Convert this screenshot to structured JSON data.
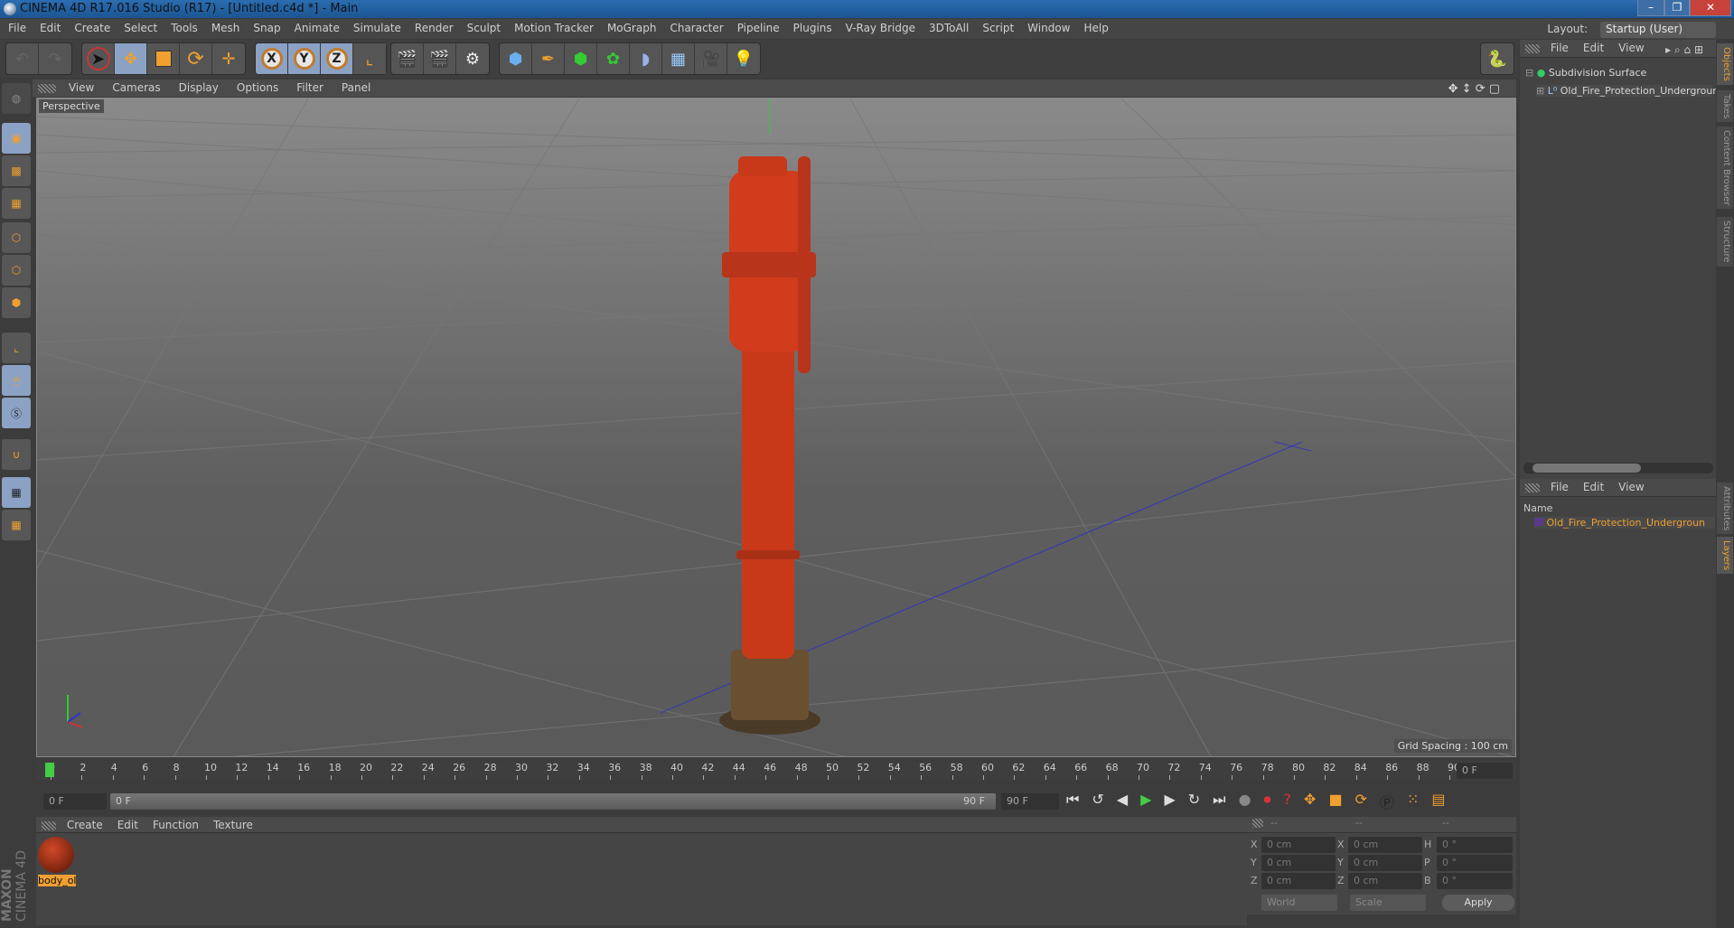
{
  "window": {
    "title": "CINEMA 4D R17.016 Studio (R17) - [Untitled.c4d *] - Main",
    "minimize": "–",
    "maximize": "❐",
    "close": "✕"
  },
  "menubar": {
    "items": [
      "File",
      "Edit",
      "Create",
      "Select",
      "Tools",
      "Mesh",
      "Snap",
      "Animate",
      "Simulate",
      "Render",
      "Sculpt",
      "Motion Tracker",
      "MoGraph",
      "Character",
      "Pipeline",
      "Plugins",
      "V-Ray Bridge",
      "3DToAll",
      "Script",
      "Window",
      "Help"
    ],
    "layout_label": "Layout:",
    "layout_value": "Startup (User)"
  },
  "toolbar": {
    "undo": "undo-icon",
    "redo": "redo-icon",
    "axis_x": "X",
    "axis_y": "Y",
    "axis_z": "Z"
  },
  "viewport": {
    "menu": [
      "View",
      "Cameras",
      "Display",
      "Options",
      "Filter",
      "Panel"
    ],
    "camera_label": "Perspective",
    "grid_spacing": "Grid Spacing : 100 cm"
  },
  "timeline": {
    "ticks": [
      "0",
      "2",
      "4",
      "6",
      "8",
      "10",
      "12",
      "14",
      "16",
      "18",
      "20",
      "22",
      "24",
      "26",
      "28",
      "30",
      "32",
      "34",
      "36",
      "38",
      "40",
      "42",
      "44",
      "46",
      "48",
      "50",
      "52",
      "54",
      "56",
      "58",
      "60",
      "62",
      "64",
      "66",
      "68",
      "70",
      "72",
      "74",
      "76",
      "78",
      "80",
      "82",
      "84",
      "86",
      "88",
      "90"
    ],
    "current_frame": "0 F",
    "start_field": "0 F",
    "range_start": "0 F",
    "range_end": "90 F",
    "end_field": "90 F"
  },
  "materials": {
    "menu": [
      "Create",
      "Edit",
      "Function",
      "Texture"
    ],
    "items": [
      {
        "name": "body_ol"
      }
    ],
    "brand_top": "MAXON",
    "brand_bottom": "CINEMA 4D"
  },
  "coordinates": {
    "headers": [
      "--",
      "--",
      "--"
    ],
    "rows": [
      {
        "l1": "X",
        "v1": "0 cm",
        "l2": "X",
        "v2": "0 cm",
        "l3": "H",
        "v3": "0 °"
      },
      {
        "l1": "Y",
        "v1": "0 cm",
        "l2": "Y",
        "v2": "0 cm",
        "l3": "P",
        "v3": "0 °"
      },
      {
        "l1": "Z",
        "v1": "0 cm",
        "l2": "Z",
        "v2": "0 cm",
        "l3": "B",
        "v3": "0 °"
      }
    ],
    "mode": "World",
    "type": "Scale",
    "apply": "Apply"
  },
  "objects_panel": {
    "menu": [
      "File",
      "Edit",
      "View"
    ],
    "items": [
      "Subdivision Surface",
      "Old_Fire_Protection_Undergroun"
    ]
  },
  "layers_panel": {
    "menu": [
      "File",
      "Edit",
      "View"
    ],
    "column": "Name",
    "items": [
      "Old_Fire_Protection_Undergroun"
    ]
  },
  "side_tabs": {
    "top": [
      "Objects",
      "Takes",
      "Content Browser",
      "Structure"
    ],
    "bottom": [
      "Attributes",
      "Layers"
    ]
  },
  "colors": {
    "accent_orange": "#f0a030",
    "active_blue": "#8ba2c4",
    "layer_color": "#5a3a8a"
  }
}
